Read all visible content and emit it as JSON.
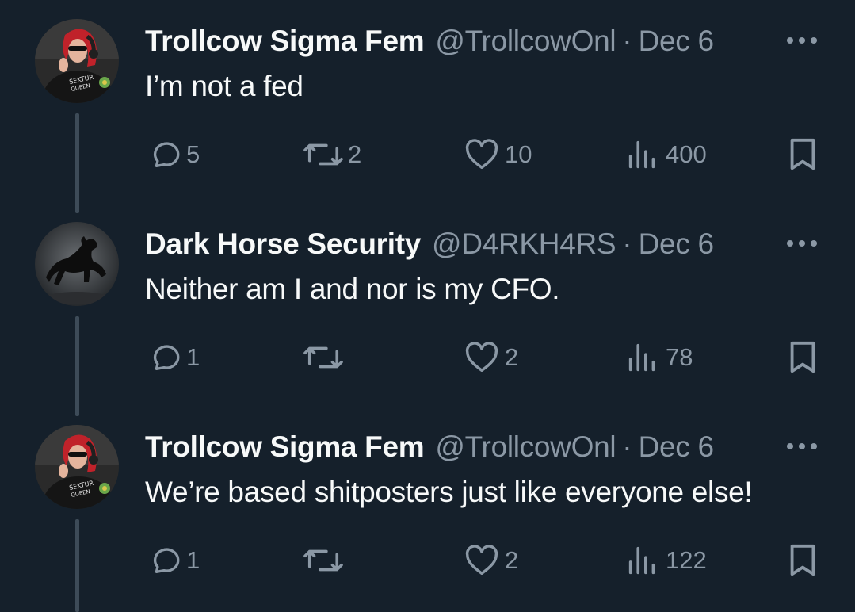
{
  "colors": {
    "background": "#15202b",
    "primary_text": "#f7f9f9",
    "secondary_text": "#8b98a5",
    "thread_line": "#3d4b58"
  },
  "tweets": [
    {
      "display_name": "Trollcow Sigma Fem",
      "handle": "@TrollcowOnl",
      "separator": "·",
      "date": "Dec 6",
      "text": "I’m not a fed",
      "avatar": "red-haired-woman-avatar",
      "replies": "5",
      "retweets": "2",
      "likes": "10",
      "views": "400"
    },
    {
      "display_name": "Dark Horse Security",
      "handle": "@D4RKH4RS",
      "separator": "·",
      "date": "Dec 6",
      "text": "Neither am I and nor is my CFO.",
      "avatar": "black-horse-avatar",
      "replies": "1",
      "retweets": "",
      "likes": "2",
      "views": "78"
    },
    {
      "display_name": "Trollcow Sigma Fem",
      "handle": "@TrollcowOnl",
      "separator": "·",
      "date": "Dec 6",
      "text": "We’re based shitposters just like everyone else!",
      "avatar": "red-haired-woman-avatar",
      "replies": "1",
      "retweets": "",
      "likes": "2",
      "views": "122"
    }
  ],
  "icons": {
    "reply": "reply-icon",
    "retweet": "retweet-icon",
    "like": "heart-icon",
    "views": "views-chart-icon",
    "bookmark": "bookmark-icon",
    "more": "more-dots-icon"
  }
}
